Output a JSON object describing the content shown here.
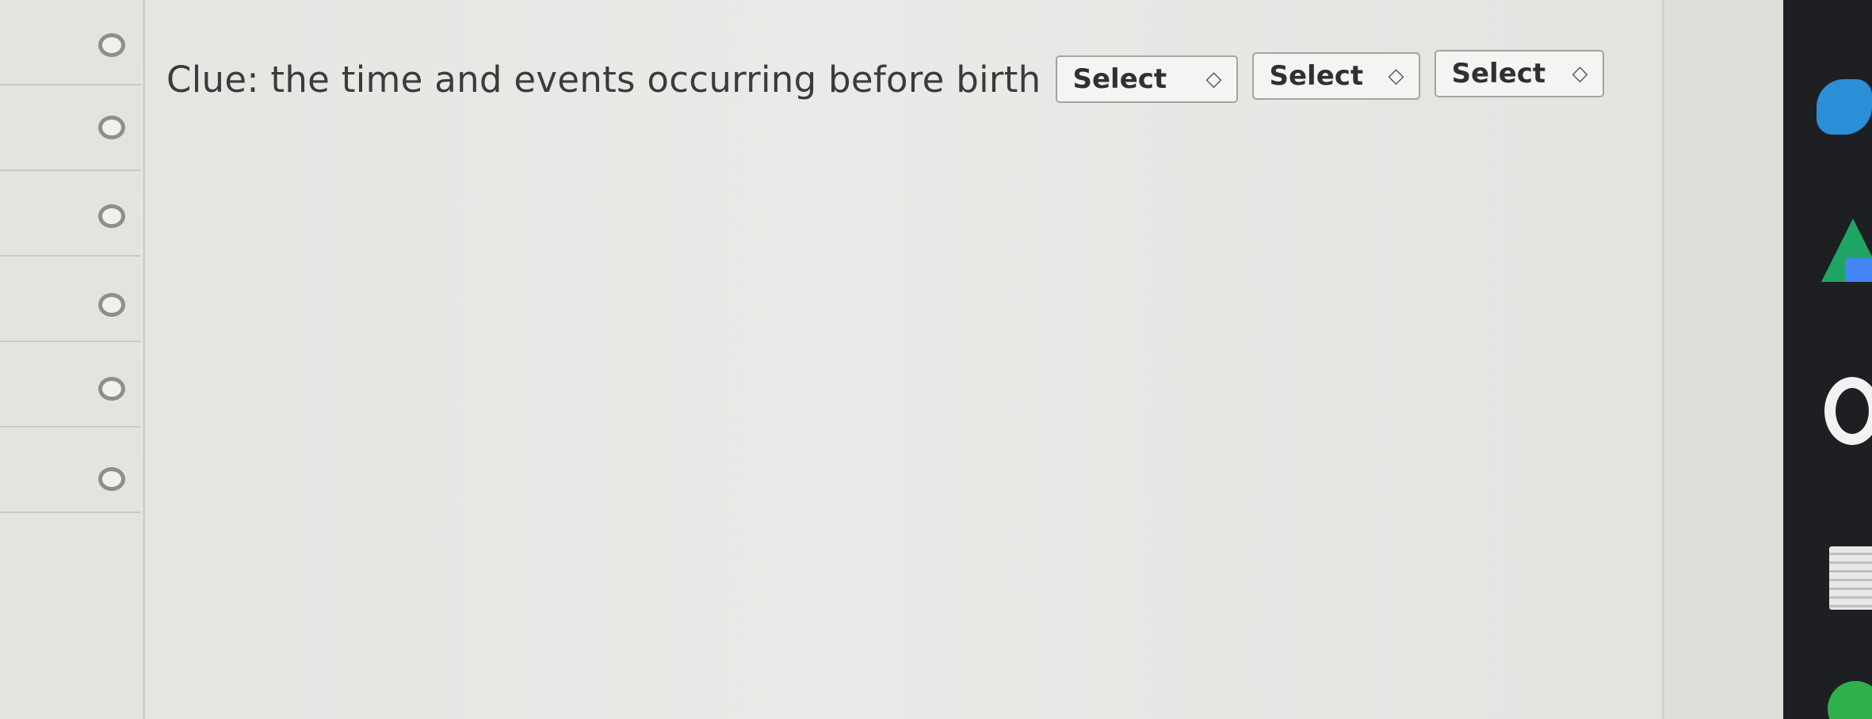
{
  "clue": {
    "text": "Clue: the time and events occurring before birth"
  },
  "selects": [
    {
      "value": "Select"
    },
    {
      "value": "Select"
    },
    {
      "value": "Select"
    }
  ],
  "radio_options_count": 6,
  "dock": {
    "icons": [
      "cloud-app-icon",
      "google-drive-icon",
      "chrome-icon",
      "notes-icon",
      "green-app-icon"
    ]
  }
}
